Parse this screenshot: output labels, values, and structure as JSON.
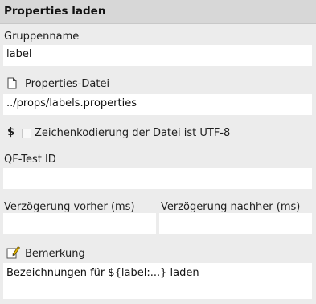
{
  "title": "Properties laden",
  "group_name": {
    "label": "Gruppenname",
    "value": "label"
  },
  "properties_file": {
    "icon": "file-icon",
    "label": "Properties-Datei",
    "value": "../props/labels.properties"
  },
  "encoding": {
    "dollar": "$",
    "checkbox_label": "Zeichenkodierung der Datei ist UTF-8",
    "checked": false
  },
  "qftest_id": {
    "label": "QF-Test ID",
    "value": ""
  },
  "delay_before": {
    "label": "Verzögerung vorher (ms)",
    "value": ""
  },
  "delay_after": {
    "label": "Verzögerung nachher (ms)",
    "value": ""
  },
  "comment": {
    "icon": "note-pencil-icon",
    "label": "Bemerkung",
    "value": "Bezeichnungen für ${label:...} laden"
  }
}
